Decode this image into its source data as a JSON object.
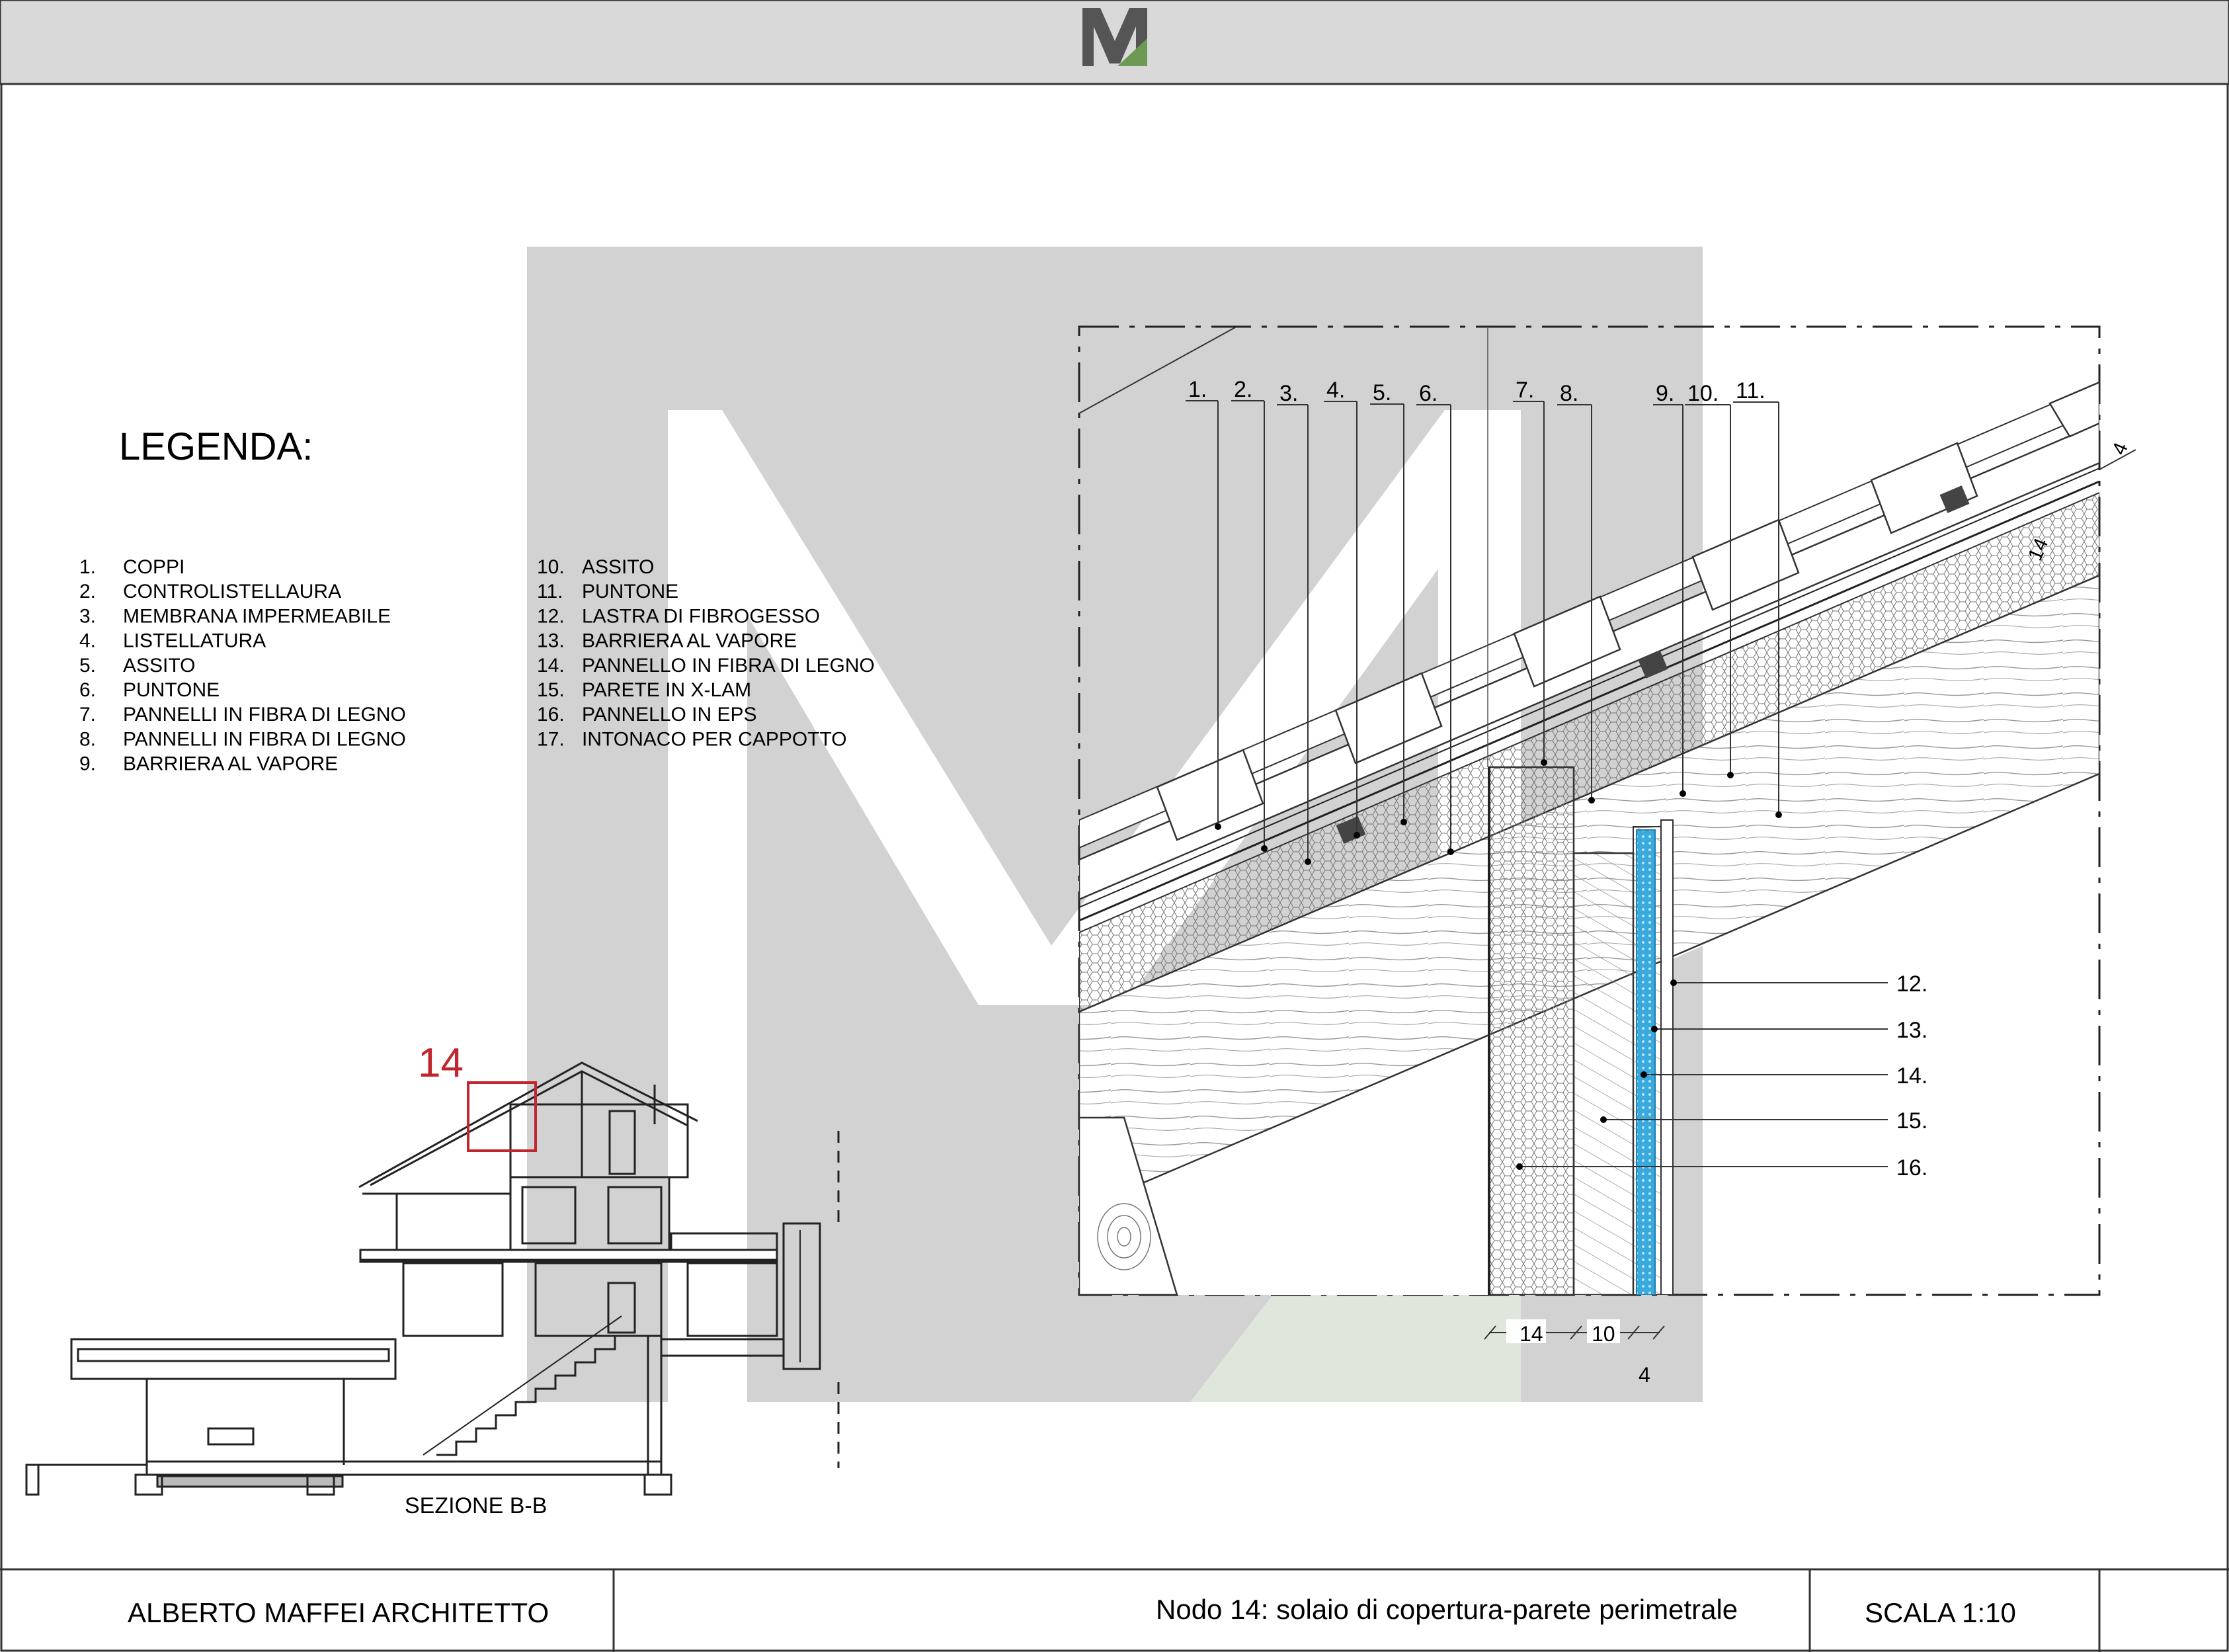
{
  "header": {
    "logo_letter": "M"
  },
  "legend": {
    "title": "LEGENDA:",
    "items": [
      {
        "num": "1.",
        "label": "COPPI"
      },
      {
        "num": "2.",
        "label": "CONTROLISTELLAURA"
      },
      {
        "num": "3.",
        "label": "MEMBRANA IMPERMEABILE"
      },
      {
        "num": "4.",
        "label": "LISTELLATURA"
      },
      {
        "num": "5.",
        "label": "ASSITO"
      },
      {
        "num": "6.",
        "label": "PUNTONE"
      },
      {
        "num": "7.",
        "label": "PANNELLI IN FIBRA DI LEGNO"
      },
      {
        "num": "8.",
        "label": "PANNELLI IN FIBRA DI LEGNO"
      },
      {
        "num": "9.",
        "label": "BARRIERA AL VAPORE"
      },
      {
        "num": "10.",
        "label": "ASSITO"
      },
      {
        "num": "11.",
        "label": "PUNTONE"
      },
      {
        "num": "12.",
        "label": "LASTRA DI FIBROGESSO"
      },
      {
        "num": "13.",
        "label": "BARRIERA AL VAPORE"
      },
      {
        "num": "14.",
        "label": "PANNELLO IN FIBRA DI LEGNO"
      },
      {
        "num": "15.",
        "label": "PARETE IN X-LAM"
      },
      {
        "num": "16.",
        "label": "PANNELLO IN EPS"
      },
      {
        "num": "17.",
        "label": "INTONACO PER CAPPOTTO"
      }
    ]
  },
  "detail": {
    "top_callouts": [
      "1.",
      "2.",
      "3.",
      "4.",
      "5.",
      "6.",
      "7.",
      "8.",
      "9.",
      "10.",
      "11."
    ],
    "side_callouts": [
      "12.",
      "13.",
      "14.",
      "15.",
      "16."
    ],
    "dimensions": {
      "d1": "14",
      "d2": "10",
      "d3": "4",
      "roof_a": "4",
      "roof_b": "14"
    }
  },
  "section": {
    "label": "SEZIONE B-B",
    "node_marker": "14"
  },
  "footer": {
    "author": "ALBERTO MAFFEI ARCHITETTO",
    "title": "Nodo 14: solaio di copertura-parete perimetrale",
    "scale": "SCALA 1:10"
  },
  "colors": {
    "background": "#ffffff",
    "header_band": "#d9d9d9",
    "watermark_gray": "#d2d2d2",
    "watermark_green": "#dfe7dc",
    "insulation_blue": "#3aa9dd",
    "logo_green": "#6c9a52",
    "marker_red": "#c0262d"
  }
}
